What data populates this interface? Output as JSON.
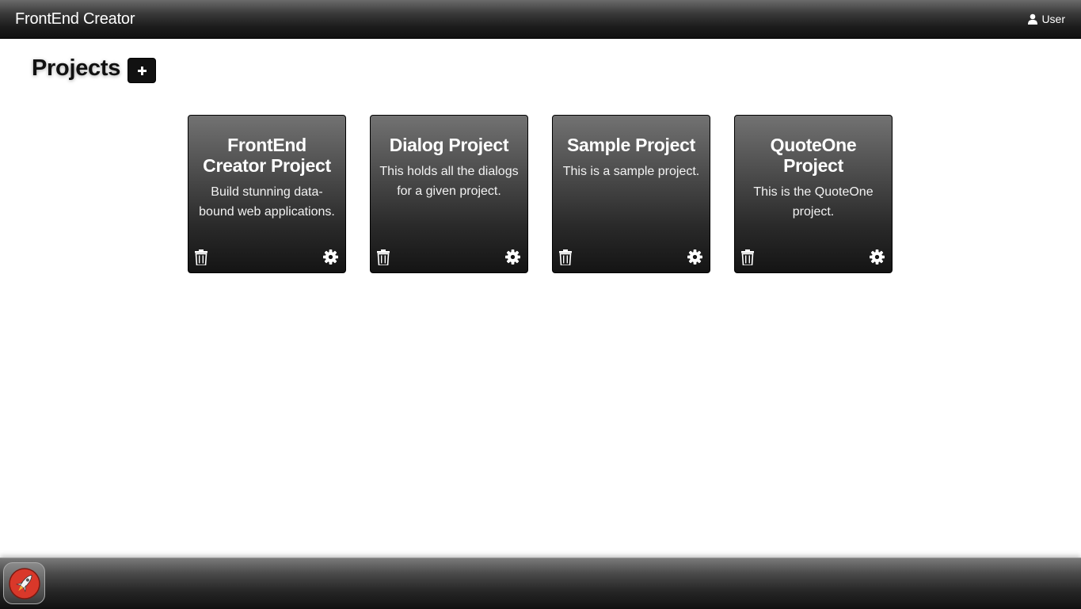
{
  "header": {
    "brand": "FrontEnd Creator",
    "user_label": "User",
    "user_icon": "user-icon"
  },
  "page": {
    "title": "Projects",
    "add_icon": "plus-icon"
  },
  "projects": [
    {
      "title": "FrontEnd Creator Project",
      "description": "Build stunning data-bound web applications."
    },
    {
      "title": "Dialog Project",
      "description": "This holds all the dialogs for a given project."
    },
    {
      "title": "Sample Project",
      "description": "This is a sample project."
    },
    {
      "title": "QuoteOne Project",
      "description": "This is the QuoteOne project."
    }
  ],
  "card_icons": {
    "delete": "trash-icon",
    "settings": "gear-icon"
  },
  "dock": {
    "launcher_icon": "rocket-icon"
  },
  "colors": {
    "header_bg": "#111111",
    "card_bg": "#2a2a2a",
    "launcher_red": "#d9382a"
  }
}
